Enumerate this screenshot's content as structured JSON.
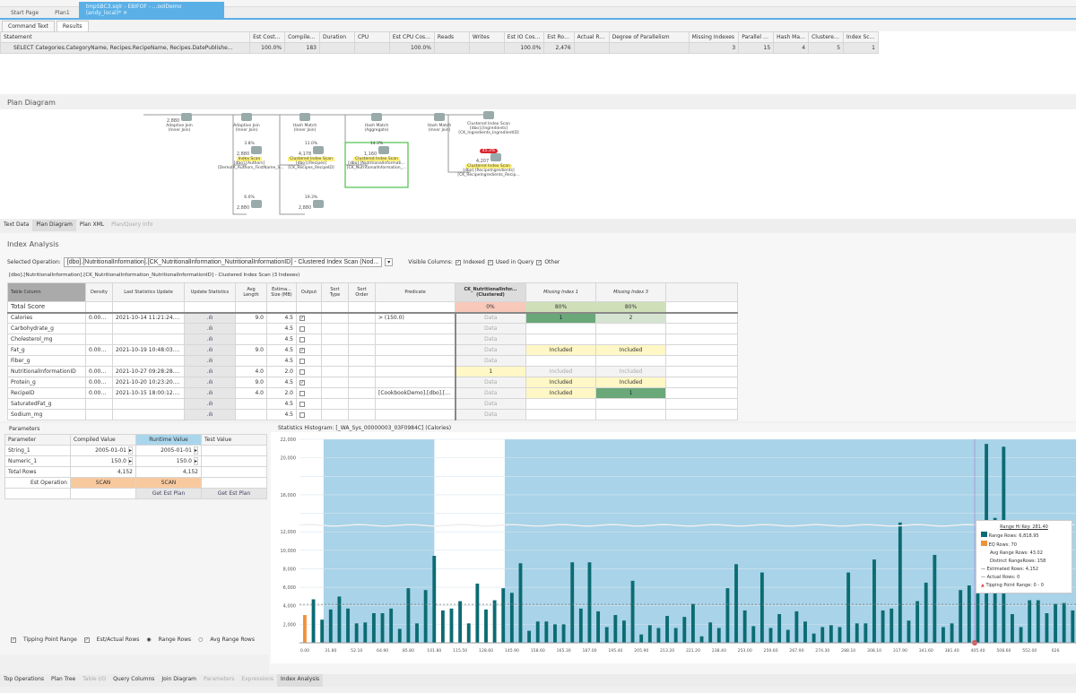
{
  "doc_tabs": [
    "Start Page",
    "Plan1",
    "tmpSBC3.sqlr - EBIFOF - ...oolDemo (andy_local)*"
  ],
  "sub_tabs": [
    "Command Text",
    "Results"
  ],
  "results": {
    "columns": [
      "Statement",
      "Est Cost %",
      "Compile Time",
      "Duration",
      "CPU",
      "Est CPU Cost %",
      "Reads",
      "Writes",
      "Est IO Cost %",
      "Est Rows",
      "Actual Rows",
      "Degree of Parallelism",
      "Missing Indexes",
      "Parallel Op...",
      "Hash Matc...",
      "Clustered I...",
      "Index Scan..."
    ],
    "rows": [
      [
        "SELECT Categories.CategoryName, Recipes.RecipeName, Recipes.DatePublishe...",
        "100.0%",
        "183",
        "",
        "",
        "100.0%",
        "",
        "",
        "100.0%",
        "2,476",
        "",
        "",
        "3",
        "15",
        "4",
        "5",
        "1"
      ]
    ]
  },
  "plan_diagram": {
    "title": "Plan Diagram",
    "nodes": [
      {
        "id": "aj1",
        "op": "Adaptive Join",
        "sub": "(Inner Join)",
        "rows": "2,880"
      },
      {
        "id": "aj2",
        "op": "Adaptive Join",
        "sub": "(Inner Join)"
      },
      {
        "id": "hm1",
        "op": "Hash Match",
        "sub": "(Inner Join)"
      },
      {
        "id": "hm2",
        "op": "Hash Match",
        "sub": "(Aggregate)"
      },
      {
        "id": "hm3",
        "op": "Hash Match",
        "sub": "(Inner Join)"
      },
      {
        "id": "ci1",
        "op": "Clustered Index Scan",
        "sub": "[dbo].[Ingredients]",
        "sub2": "[CK_Ingredients_IngredientID]"
      },
      {
        "id": "is1",
        "pct": "3.8%",
        "op": "Index Scan",
        "sub": "[dbo].[Authors]",
        "sub2": "[DemoIX_Authors_FirstName_S...",
        "rows": "2,880"
      },
      {
        "id": "ci2",
        "pct": "11.0%",
        "op": "Clustered Index Scan",
        "sub": "[dbo].[Recipes]",
        "sub2": "[CK_Recipes_RecipeID]",
        "rows": "4,178"
      },
      {
        "id": "ci3",
        "pct": "14.3%",
        "op": "Clustered Index Scan",
        "sub": "[dbo].[NutritionalInformati...",
        "sub2": "[CK_NutritionalInformation_...",
        "rows": "1,160"
      },
      {
        "id": "ci4",
        "pct": "45.3%",
        "op": "Clustered Index Scan",
        "sub": "[dbo].[RecipeIngredients]",
        "sub2": "[CK_RecipeIngredients_Recip...",
        "rows": "4,207"
      },
      {
        "id": "b1",
        "pct": "6.0%",
        "rows": "2,880"
      },
      {
        "id": "b2",
        "pct": "19.3%",
        "rows": "2,880"
      }
    ]
  },
  "plan_tabs": [
    "Text Data",
    "Plan Diagram",
    "Plan XML",
    "Plan/Query Info"
  ],
  "index_analysis": {
    "title": "Index Analysis",
    "selected_operation_label": "Selected Operation:",
    "selected_operation": "[dbo].[NutritionalInformation].[CK_NutritionalInformation_NutritionalInformationID] - Clustered Index Scan (Nod...",
    "visible_columns_label": "Visible Columns:",
    "visible_columns": [
      {
        "label": "Indexed",
        "checked": true
      },
      {
        "label": "Used in Query",
        "checked": true
      },
      {
        "label": "Other",
        "checked": true
      }
    ],
    "caption": "[dbo].[NutritionalInformation].[CK_NutritionalInformation_NutritionalInformationID] - Clustered Index Scan (3 Indexes)",
    "columns": [
      "Table Column",
      "Density",
      "Last Statistics Update",
      "Update Statistics",
      "Avg Length",
      "Estima... Size (MB)",
      "Output",
      "Sort Type",
      "Sort Order",
      "Predicate",
      "CK_NutritionalInfor... (Clustered)",
      "Missing Index 1",
      "Missing Index 3"
    ],
    "total_score_label": "Total Score",
    "scores": [
      "0%",
      "80%",
      "80%"
    ],
    "rows": [
      {
        "name": "Calories",
        "bold": true,
        "density": "0.000062",
        "updated": "2021-10-14 11:21:24.663",
        "avg": "9.0",
        "size": "4.5",
        "output": true,
        "predicate": "> (150.0)",
        "ck": "Data",
        "mi1": "1",
        "mi2": "2"
      },
      {
        "name": "Carbohydrate_g",
        "bold": false,
        "density": "",
        "updated": "",
        "avg": "",
        "size": "4.5",
        "output": false,
        "predicate": "",
        "ck": "Data",
        "mi1": "",
        "mi2": ""
      },
      {
        "name": "Cholesterol_mg",
        "bold": false,
        "density": "",
        "updated": "",
        "avg": "",
        "size": "4.5",
        "output": false,
        "predicate": "",
        "ck": "Data",
        "mi1": "",
        "mi2": ""
      },
      {
        "name": "Fat_g",
        "bold": true,
        "density": "0.000374",
        "updated": "2021-10-19 10:48:03.175",
        "avg": "9.0",
        "size": "4.5",
        "output": true,
        "predicate": "",
        "ck": "Data",
        "mi1": "Included",
        "mi2": "Included"
      },
      {
        "name": "Fiber_g",
        "bold": false,
        "density": "",
        "updated": "",
        "avg": "",
        "size": "4.5",
        "output": false,
        "predicate": "",
        "ck": "Data",
        "mi1": "",
        "mi2": ""
      },
      {
        "name": "NutritionalInformationID",
        "bold": false,
        "density": "0.000002",
        "updated": "2021-10-27 09:28:28.857",
        "avg": "4.0",
        "size": "2.0",
        "output": false,
        "predicate": "",
        "ck": "1",
        "mi1": "Included",
        "mi2": "Included"
      },
      {
        "name": "Protein_g",
        "bold": true,
        "density": "0.000618",
        "updated": "2021-10-20 10:23:20.753",
        "avg": "9.0",
        "size": "4.5",
        "output": true,
        "predicate": "",
        "ck": "Data",
        "mi1": "Included",
        "mi2": "Included"
      },
      {
        "name": "RecipeID",
        "bold": true,
        "density": "0.000002",
        "updated": "2021-10-15 18:00:12.075",
        "avg": "4.0",
        "size": "2.0",
        "output": false,
        "predicate": "[CookbookDemo].[dbo].[Re...",
        "ck": "Data",
        "mi1": "Included",
        "mi2": "1"
      },
      {
        "name": "SaturatedFat_g",
        "bold": false,
        "density": "",
        "updated": "",
        "avg": "",
        "size": "4.5",
        "output": false,
        "predicate": "",
        "ck": "Data",
        "mi1": "",
        "mi2": ""
      },
      {
        "name": "Sodium_mg",
        "bold": false,
        "density": "",
        "updated": "",
        "avg": "",
        "size": "4.5",
        "output": false,
        "predicate": "",
        "ck": "Data",
        "mi1": "",
        "mi2": ""
      }
    ]
  },
  "parameters": {
    "title": "Parameters",
    "columns": [
      "Parameter",
      "Compiled Value",
      "Runtime Value",
      "Test Value"
    ],
    "rows": [
      [
        "String_1",
        "2005-01-01",
        "2005-01-01",
        ""
      ],
      [
        "Numeric_1",
        "150.0",
        "150.0",
        ""
      ]
    ],
    "total_rows": [
      "Total Rows",
      "4,152",
      "4,152",
      ""
    ],
    "est_operation": [
      "Est Operation",
      "SCAN",
      "SCAN",
      ""
    ],
    "get_plan_label": "Get Est Plan",
    "options": {
      "tipping_point_range": "Tipping Point Range",
      "est_actual_rows": "Est/Actual Rows",
      "range_rows": "Range Rows",
      "avg_range_rows": "Avg Range Rows"
    },
    "options_state": {
      "tipping_point_range": true,
      "est_actual_rows": true,
      "selected": "range_rows"
    }
  },
  "chart_data": {
    "type": "bar",
    "title": "Statistics Histogram: [_WA_Sys_00000003_03F0984C] (Calories)",
    "y_tick_labels": [
      "22,000",
      "20,000",
      "16,000",
      "12,000",
      "10,000",
      "8,000",
      "6,000",
      "4,000",
      "2,000"
    ],
    "ylim": [
      0,
      22000
    ],
    "x_tick_labels": [
      "0.00",
      "31.80",
      "52.10",
      "64.90",
      "85.80",
      "101.80",
      "115.50",
      "128.60",
      "145.90",
      "158.60",
      "165.30",
      "187.00",
      "195.40",
      "205.90",
      "213.20",
      "221.20",
      "238.40",
      "253.00",
      "259.60",
      "267.90",
      "274.30",
      "288.10",
      "308.10",
      "317.90",
      "341.60",
      "381.40",
      "405.40",
      "508.60",
      "552.00",
      "626"
    ],
    "eq_rows_first": 3000,
    "range_rows": [
      4700,
      2500,
      3600,
      5000,
      3700,
      2100,
      2200,
      3200,
      3200,
      3700,
      1500,
      5900,
      2100,
      5700,
      9400,
      3500,
      3700,
      4500,
      2100,
      6400,
      3600,
      4600,
      5900,
      5400,
      8600,
      1300,
      2300,
      2300,
      2000,
      2000,
      8700,
      3700,
      8700,
      3400,
      1700,
      3000,
      2400,
      6700,
      900,
      1900,
      1600,
      2900,
      1600,
      2800,
      4200,
      700,
      2200,
      1600,
      5900,
      8500,
      3500,
      1800,
      7600,
      1600,
      3100,
      1400,
      3400,
      2300,
      1000,
      1700,
      1900,
      1700,
      7600,
      2100,
      2100,
      9000,
      3500,
      3700,
      13000,
      2400,
      4500,
      6500,
      9500,
      1700,
      2100,
      5700,
      6200,
      6818.95,
      21500,
      13500,
      21200,
      3100,
      1700,
      4600,
      4600,
      3200,
      4200,
      4300,
      3500
    ],
    "estimated_rows": 4152,
    "white_line_value": 12700,
    "shaded_ranges": [
      [
        "31.80",
        "101.80"
      ],
      [
        "145.90",
        "626"
      ]
    ],
    "colors": {
      "range_rows": "#0b6b73",
      "eq_rows": "#f0923a",
      "shade": "#a8d3e8",
      "tipping": "#e05050"
    },
    "tooltip": {
      "title": "Range Hi Key: 281.40",
      "lines": [
        "Range Rows: 6,818.95",
        "EQ Rows: 70",
        "Avg Range Rows: 43.02",
        "Distinct RangeRows: 158",
        "Estimated Rows: 4,152",
        "Actual Rows: 0",
        "Tipping Point Range: 0 - 0"
      ]
    }
  },
  "bottom_tabs": [
    {
      "label": "Top Operations",
      "enabled": true
    },
    {
      "label": "Plan Tree",
      "enabled": true
    },
    {
      "label": "Table I/O",
      "enabled": false
    },
    {
      "label": "Query Columns",
      "enabled": true
    },
    {
      "label": "Join Diagram",
      "enabled": true
    },
    {
      "label": "Parameters",
      "enabled": false
    },
    {
      "label": "Expressions",
      "enabled": false
    },
    {
      "label": "Index Analysis",
      "enabled": true,
      "active": true
    }
  ]
}
